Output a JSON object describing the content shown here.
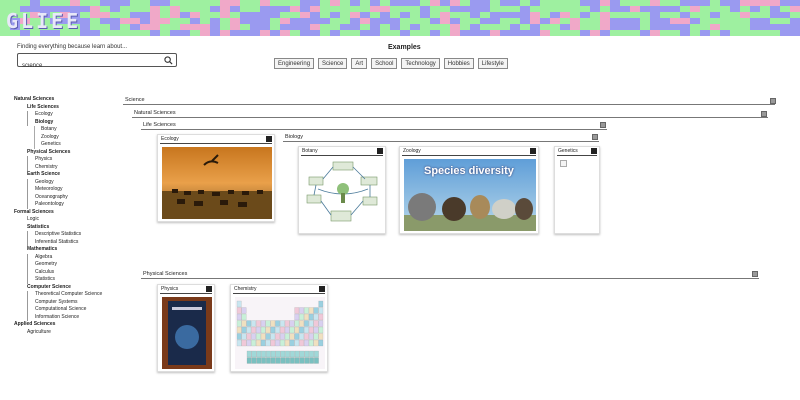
{
  "header": {
    "logo": "GLIEE"
  },
  "search": {
    "prompt": "Finding everything because learn about...",
    "value": "science",
    "icon": "magnifier-icon"
  },
  "examples": {
    "title": "Examples",
    "items": [
      "Engineering",
      "Science",
      "Art",
      "School",
      "Technology",
      "Hobbies",
      "Lifestyle"
    ]
  },
  "tree": [
    {
      "level": "l0",
      "label": "Natural Sciences"
    },
    {
      "level": "l1b",
      "label": "Life Sciences"
    },
    {
      "level": "l2",
      "label": "Ecology"
    },
    {
      "level": "l2b",
      "label": "Biology"
    },
    {
      "level": "l3",
      "label": "Botany"
    },
    {
      "level": "l3",
      "label": "Zoology"
    },
    {
      "level": "l3",
      "label": "Genetics"
    },
    {
      "level": "l1b",
      "label": "Physical Sciences"
    },
    {
      "level": "l2",
      "label": "Physics"
    },
    {
      "level": "l2",
      "label": "Chemistry"
    },
    {
      "level": "l1b",
      "label": "Earth Science"
    },
    {
      "level": "l2",
      "label": "Geology"
    },
    {
      "level": "l2",
      "label": "Meteorology"
    },
    {
      "level": "l2",
      "label": "Oceanography"
    },
    {
      "level": "l2",
      "label": "Paleontology"
    },
    {
      "level": "l0",
      "label": "Formal Sciences"
    },
    {
      "level": "l1",
      "label": "Logic"
    },
    {
      "level": "l1b",
      "label": "Statistics"
    },
    {
      "level": "l2",
      "label": "Descriptive Statistics"
    },
    {
      "level": "l2",
      "label": "Inferential Statistics"
    },
    {
      "level": "l1b",
      "label": "Mathematics"
    },
    {
      "level": "l2",
      "label": "Algebra"
    },
    {
      "level": "l2",
      "label": "Geometry"
    },
    {
      "level": "l2",
      "label": "Calculus"
    },
    {
      "level": "l2",
      "label": "Statistics"
    },
    {
      "level": "l1b",
      "label": "Computer Science"
    },
    {
      "level": "l2",
      "label": "Theoretical Computer Science"
    },
    {
      "level": "l2",
      "label": "Computer Systems"
    },
    {
      "level": "l2",
      "label": "Computational Science"
    },
    {
      "level": "l2",
      "label": "Information Science"
    },
    {
      "level": "l0",
      "label": "Applied Sciences"
    },
    {
      "level": "l1",
      "label": "Agriculture"
    }
  ],
  "panels": {
    "science": "Science",
    "natural": "Natural Sciences",
    "life": "Life Sciences",
    "biology": "Biology",
    "physical": "Physical Sciences"
  },
  "cards": {
    "ecology": "Ecology",
    "botany": "Botany",
    "zoology": "Zoology",
    "zoology_caption": "Species diversity",
    "genetics": "Genetics",
    "physics": "Physics",
    "chemistry": "Chemistry"
  },
  "colors": {
    "banner_green": "#9ef0a0",
    "banner_purple": "#9a9af0",
    "banner_pink": "#f0a8c8"
  }
}
